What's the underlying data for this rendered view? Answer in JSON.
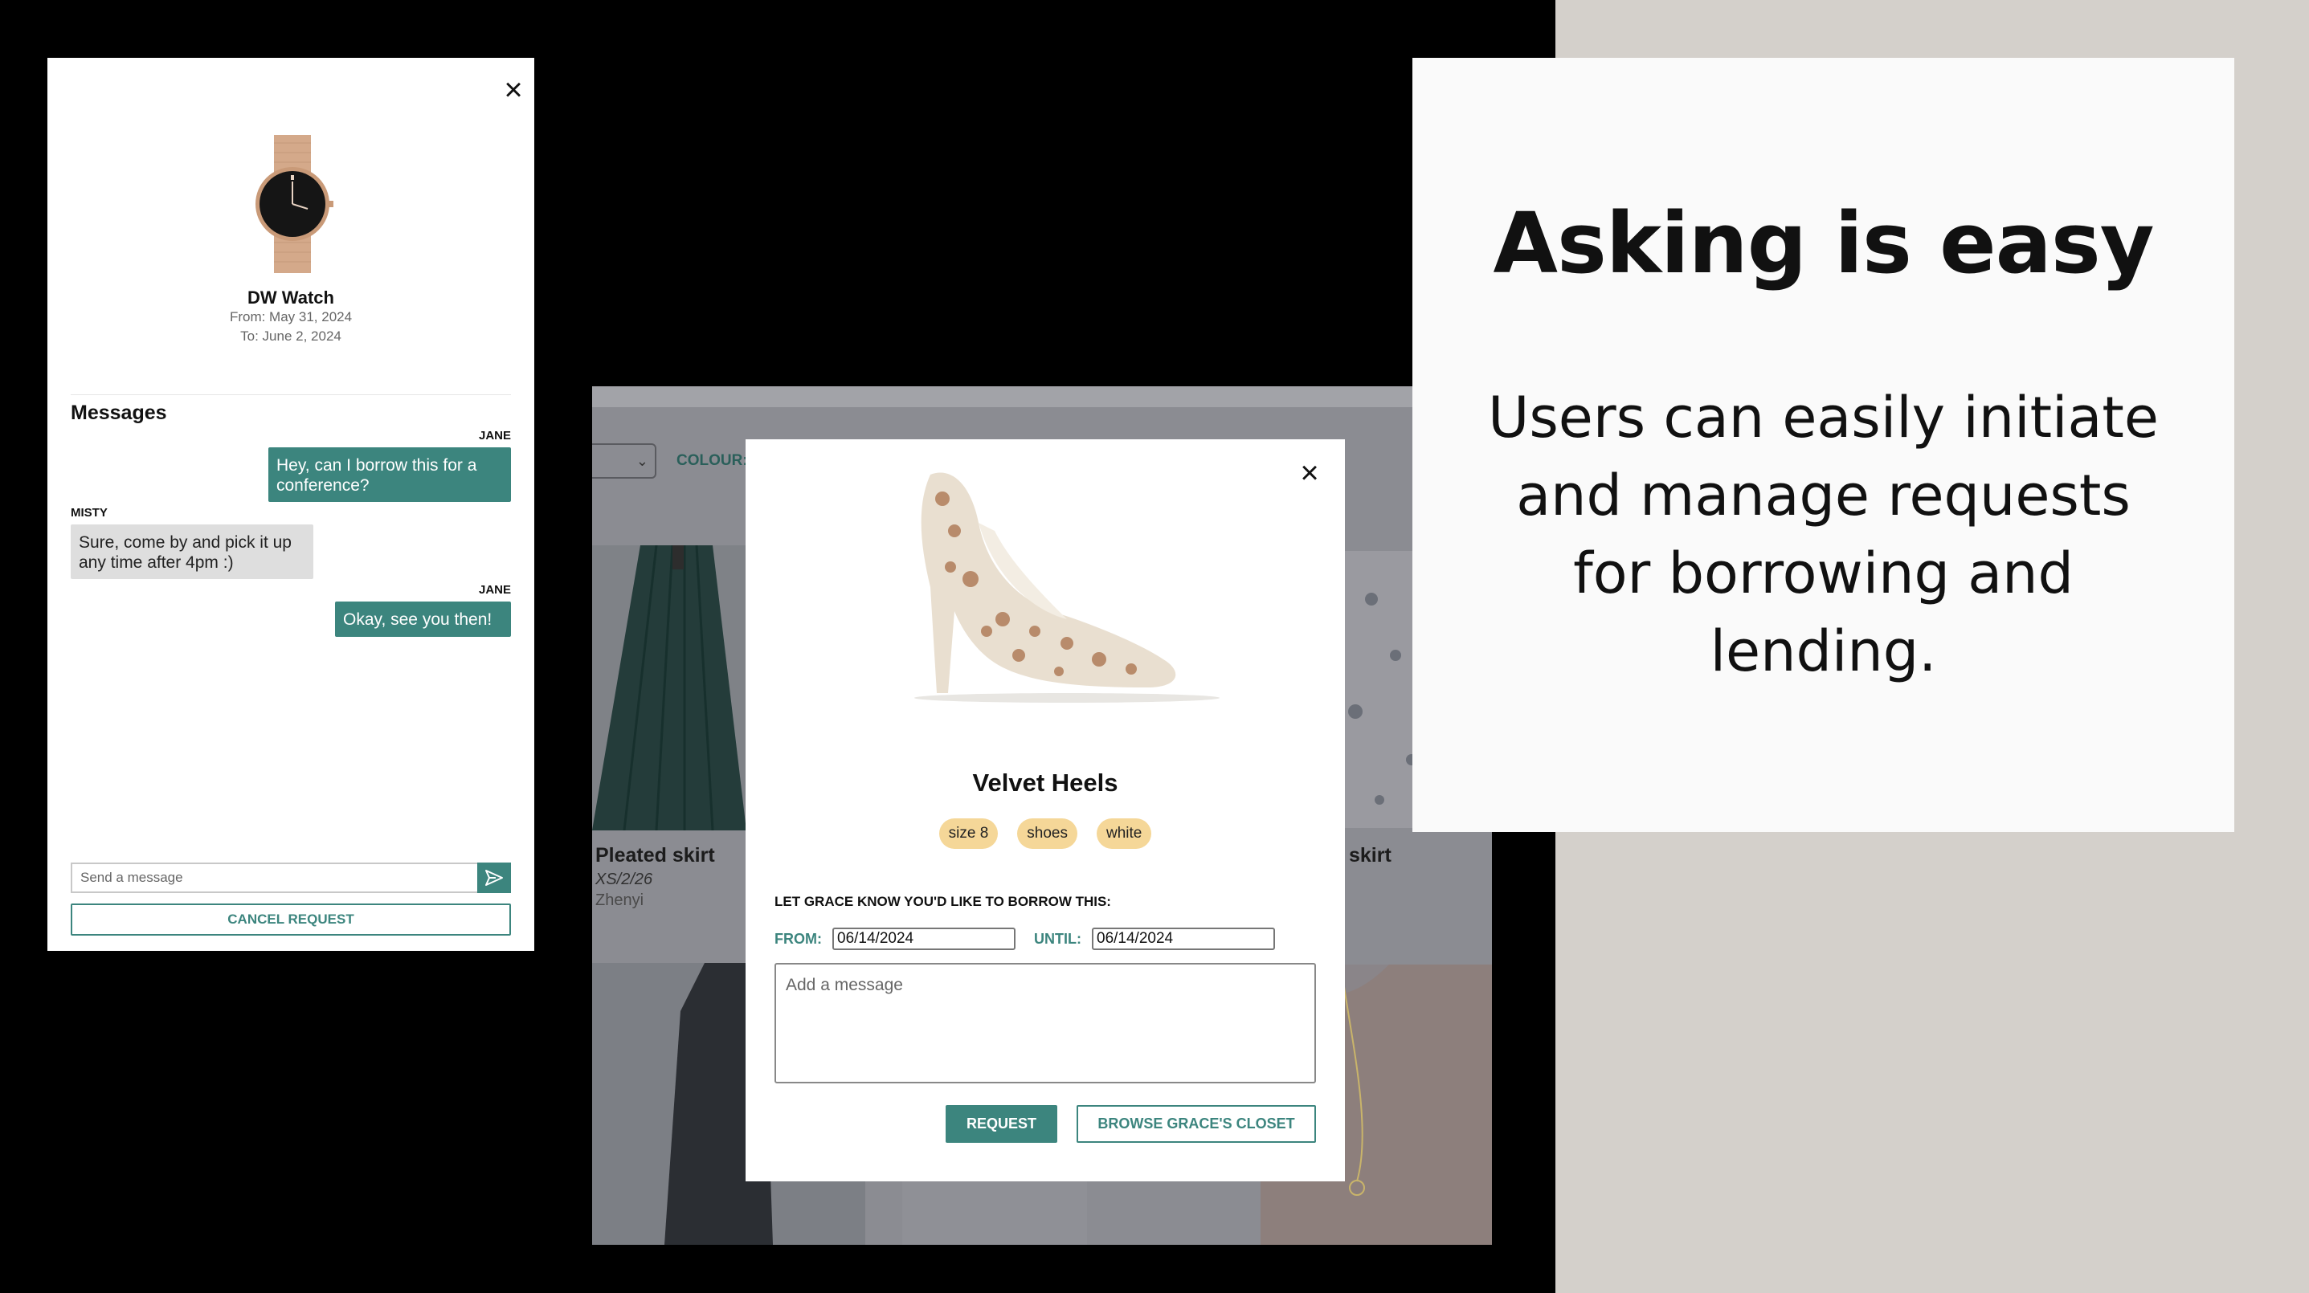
{
  "request_panel": {
    "item_title": "DW Watch",
    "from": "From: May 31, 2024",
    "to": "To: June 2, 2024",
    "messages_heading": "Messages",
    "messages": [
      {
        "sender": "JANE",
        "text": "Hey, can I borrow this for a conference?",
        "direction": "outgoing"
      },
      {
        "sender": "MISTY",
        "text": "Sure, come by and pick it up any time after 4pm :)",
        "direction": "incoming"
      },
      {
        "sender": "JANE",
        "text": "Okay, see you then!",
        "direction": "outgoing"
      }
    ],
    "input_placeholder": "Send a message",
    "cancel_label": "CANCEL REQUEST"
  },
  "closet": {
    "colour_label": "COLOUR:",
    "items": [
      {
        "title": "Pleated skirt",
        "size": "XS/2/26",
        "owner": "Zhenyi"
      },
      {
        "title": "skirt"
      }
    ]
  },
  "modal": {
    "title": "Velvet Heels",
    "tags": [
      "size 8",
      "shoes",
      "white"
    ],
    "prompt": "LET GRACE KNOW YOU'D LIKE TO BORROW THIS:",
    "from_label": "FROM:",
    "from_value": "06/14/2024",
    "until_label": "UNTIL:",
    "until_value": "06/14/2024",
    "message_placeholder": "Add a message",
    "request_label": "REQUEST",
    "browse_label": "BROWSE GRACE'S CLOSET"
  },
  "info": {
    "headline": "Asking is easy",
    "body": "Users can easily initiate and manage requests for borrowing and lending."
  },
  "colors": {
    "accent": "#3c857e",
    "tag": "#f5d798",
    "bubble_incoming": "#dedede",
    "page_bg": "#000000",
    "side_bg": "#d4d0cb"
  }
}
